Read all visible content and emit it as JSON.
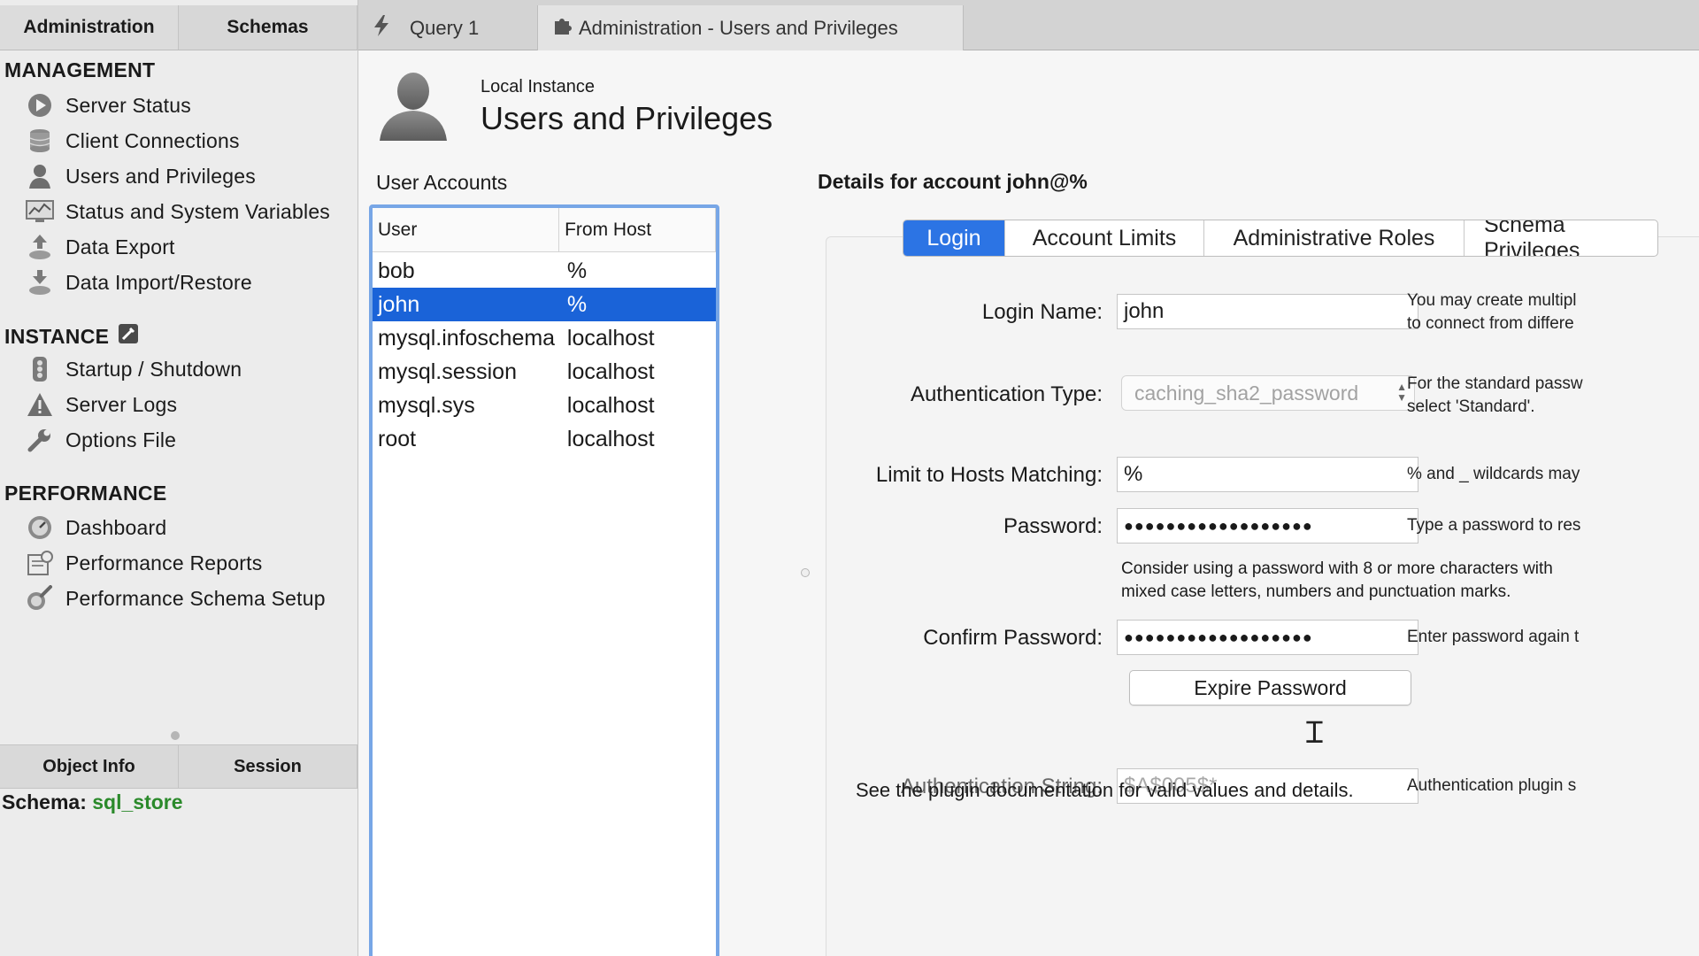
{
  "sidebar": {
    "tabs": [
      "Administration",
      "Schemas"
    ],
    "sections": [
      {
        "title": "MANAGEMENT",
        "items": [
          "Server Status",
          "Client Connections",
          "Users and Privileges",
          "Status and System Variables",
          "Data Export",
          "Data Import/Restore"
        ]
      },
      {
        "title": "INSTANCE",
        "items": [
          "Startup / Shutdown",
          "Server Logs",
          "Options File"
        ]
      },
      {
        "title": "PERFORMANCE",
        "items": [
          "Dashboard",
          "Performance Reports",
          "Performance Schema Setup"
        ]
      }
    ],
    "info_tabs": [
      "Object Info",
      "Session"
    ],
    "schema_label": "Schema:",
    "schema_value": "sql_store"
  },
  "doc_tabs": [
    "Query 1",
    "Administration - Users and Privileges"
  ],
  "header": {
    "subtitle": "Local Instance",
    "title": "Users and Privileges"
  },
  "user_accounts": {
    "label": "User Accounts",
    "columns": [
      "User",
      "From Host"
    ],
    "rows": [
      {
        "user": "bob",
        "host": "%"
      },
      {
        "user": "john",
        "host": "%"
      },
      {
        "user": "mysql.infoschema",
        "host": "localhost"
      },
      {
        "user": "mysql.session",
        "host": "localhost"
      },
      {
        "user": "mysql.sys",
        "host": "localhost"
      },
      {
        "user": "root",
        "host": "localhost"
      }
    ],
    "selected_index": 1
  },
  "details": {
    "title": "Details for account john@%",
    "tabs": [
      "Login",
      "Account Limits",
      "Administrative Roles",
      "Schema Privileges"
    ],
    "active_tab": "Login",
    "login_name_label": "Login Name:",
    "login_name_value": "john",
    "login_name_help": [
      "You may create multipl",
      "to connect from differe"
    ],
    "auth_type_label": "Authentication Type:",
    "auth_type_value": "caching_sha2_password",
    "auth_type_help": [
      "For the standard passw",
      "select 'Standard'."
    ],
    "hosts_label": "Limit to Hosts Matching:",
    "hosts_value": "%",
    "hosts_help": "% and _ wildcards may",
    "password_label": "Password:",
    "password_value": "●●●●●●●●●●●●●●●●●●",
    "password_help": "Type a password to res",
    "password_hint": [
      "Consider using a password with 8 or more characters with",
      "mixed case letters, numbers and punctuation marks."
    ],
    "confirm_label": "Confirm Password:",
    "confirm_value": "●●●●●●●●●●●●●●●●●●",
    "confirm_help": "Enter password again t",
    "expire_button": "Expire Password",
    "auth_string_label": "Authentication String:",
    "auth_string_value": "$A$005$*",
    "auth_string_help": "Authentication plugin s",
    "plugin_note": "See the plugin documentation for valid values and details."
  },
  "colors": {
    "accent": "#2c74e4",
    "selection": "#1a63d8",
    "schema": "#2b8a2b"
  }
}
